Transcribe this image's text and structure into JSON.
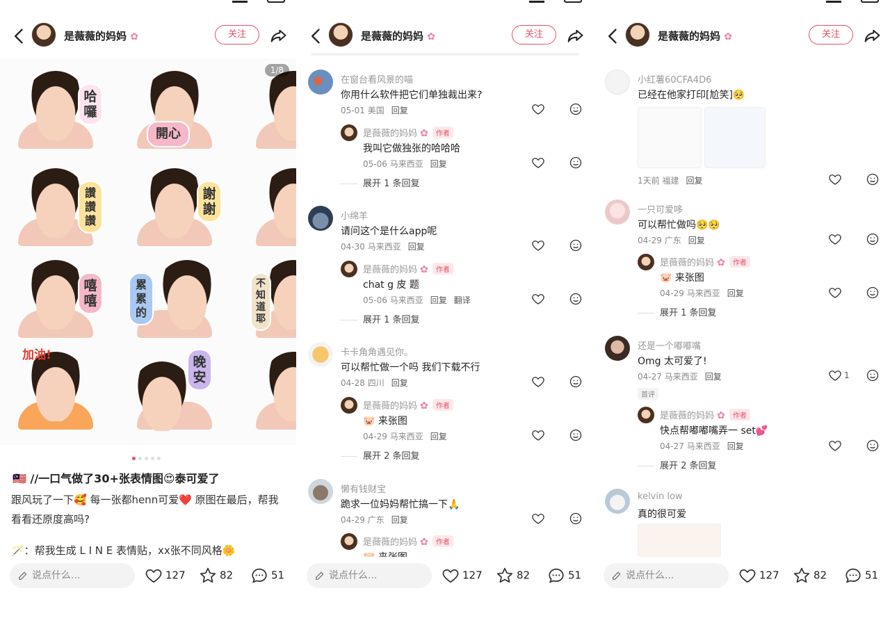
{
  "post": {
    "author": "是薇薇的妈妈",
    "follow": "关注",
    "counter": "1/8",
    "title": "🇲🇾 //一口气做了30+张表情图😍泰可爱了",
    "body": "跟风玩了一下🥰 每一张都henn可爱❤️ 原图在最后，帮我看看还原度高吗?",
    "line3": "🪄：帮我生成 L I N E 表情贴，xx张不同风格🌼",
    "stickers": [
      "哈囉",
      "開心",
      "讚讚讚",
      "謝謝",
      "嘻嘻",
      "累累的",
      "不知道耶",
      "加油!",
      "晚安"
    ]
  },
  "bottom": {
    "say": "说点什么...",
    "likes": "127",
    "stars": "82",
    "comments": "51"
  },
  "panel2": [
    {
      "name": "在窗台看风景的喵",
      "text": "你用什么软件把它们单独裁出来?",
      "date": "05-01",
      "loc": "美国",
      "reply": "回复",
      "sub": {
        "name": "是薇薇的妈妈",
        "tag": "作者",
        "text": "我叫它做独张的哈哈哈",
        "date": "05-06",
        "loc": "马来西亚",
        "reply": "回复"
      },
      "more": "展开 1 条回复"
    },
    {
      "name": "小绵羊",
      "text": "请问这个是什么app呢",
      "date": "04-30",
      "loc": "马来西亚",
      "reply": "回复",
      "sub": {
        "name": "是薇薇的妈妈",
        "tag": "作者",
        "text": "chat g 皮 题",
        "date": "05-06",
        "loc": "马来西亚",
        "reply": "回复",
        "extra": "翻译"
      },
      "more": "展开 1 条回复"
    },
    {
      "name": "卡卡角角遇见你。",
      "text": "可以帮忙做一个吗 我们下载不行",
      "date": "04-28",
      "loc": "四川",
      "reply": "回复",
      "sub": {
        "name": "是薇薇的妈妈",
        "tag": "作者",
        "text": "🐷 来张图",
        "date": "04-29",
        "loc": "马来西亚",
        "reply": "回复"
      },
      "more": "展开 2 条回复"
    },
    {
      "name": "懒有钱财宝",
      "text": "跪求一位妈妈帮忙搞一下🙏",
      "date": "04-29",
      "loc": "广东",
      "reply": "回复",
      "sub": {
        "name": "是薇薇的妈妈",
        "tag": "作者",
        "text": "🐷 来张图"
      }
    }
  ],
  "panel3": [
    {
      "name": "小红薯60CFA4D6",
      "text": "已经在他家打印[尬笑]🥺",
      "date": "1天前",
      "loc": "福建",
      "reply": "回复"
    },
    {
      "name": "一只可爱哆",
      "text": "可以帮忙做吗🥺🥺",
      "date": "04-29",
      "loc": "广东",
      "reply": "回复",
      "sub": {
        "name": "是薇薇的妈妈",
        "tag": "作者",
        "text": "🐷 来张图",
        "date": "04-29",
        "loc": "马来西亚",
        "reply": "回复"
      },
      "more": "展开 1 条回复"
    },
    {
      "name": "还是一个嘟嘟嘴",
      "text": "Omg 太可爱了!",
      "date": "04-27",
      "loc": "马来西亚",
      "reply": "回复",
      "likes": "1",
      "badge": "首评",
      "sub": {
        "name": "是薇薇的妈妈",
        "tag": "作者",
        "text": "快点帮嘟嘟嘴弄一 set💕",
        "date": "04-27",
        "loc": "马来西亚",
        "reply": "回复"
      },
      "more": "展开 2 条回复"
    },
    {
      "name": "kelvin low",
      "text": "真的很可爱"
    }
  ],
  "colors": {
    "accent": "#ec4e66",
    "meta": "#888888",
    "flower": "#ee7fa6"
  }
}
